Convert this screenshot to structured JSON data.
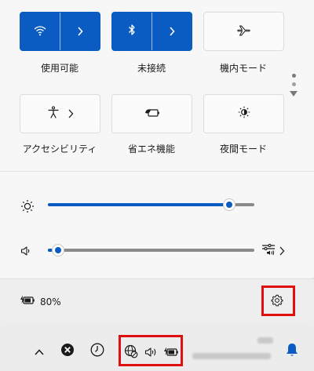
{
  "quick_settings": {
    "tiles": [
      {
        "label": "使用可能",
        "icon": "wifi-icon",
        "state": "on",
        "expandable": true
      },
      {
        "label": "未接続",
        "icon": "bluetooth-icon",
        "state": "on",
        "expandable": true
      },
      {
        "label": "機内モード",
        "icon": "airplane-icon",
        "state": "off",
        "expandable": false
      },
      {
        "label": "アクセシビリティ",
        "icon": "accessibility-icon",
        "state": "off",
        "expandable": true
      },
      {
        "label": "省エネ機能",
        "icon": "energy-saver-icon",
        "state": "off",
        "expandable": false
      },
      {
        "label": "夜間モード",
        "icon": "night-light-icon",
        "state": "off",
        "expandable": false
      }
    ],
    "brightness": {
      "icon": "brightness-icon",
      "level": 0.88
    },
    "volume": {
      "icon": "speaker-icon",
      "level": 0.05,
      "output_icon": "audio-output-icon"
    }
  },
  "footer": {
    "battery_icon": "battery-charging-icon",
    "battery_percent": "80%",
    "settings_icon": "gear-icon"
  },
  "taskbar": {
    "icons": [
      "chevron-up-icon",
      "close-circle-icon",
      "clock-icon",
      "globe-no-internet-icon",
      "volume-icon",
      "battery-charging-icon",
      "notification-bell-icon"
    ]
  },
  "colors": {
    "accent": "#0a5cc2",
    "highlight": "#e01010"
  }
}
